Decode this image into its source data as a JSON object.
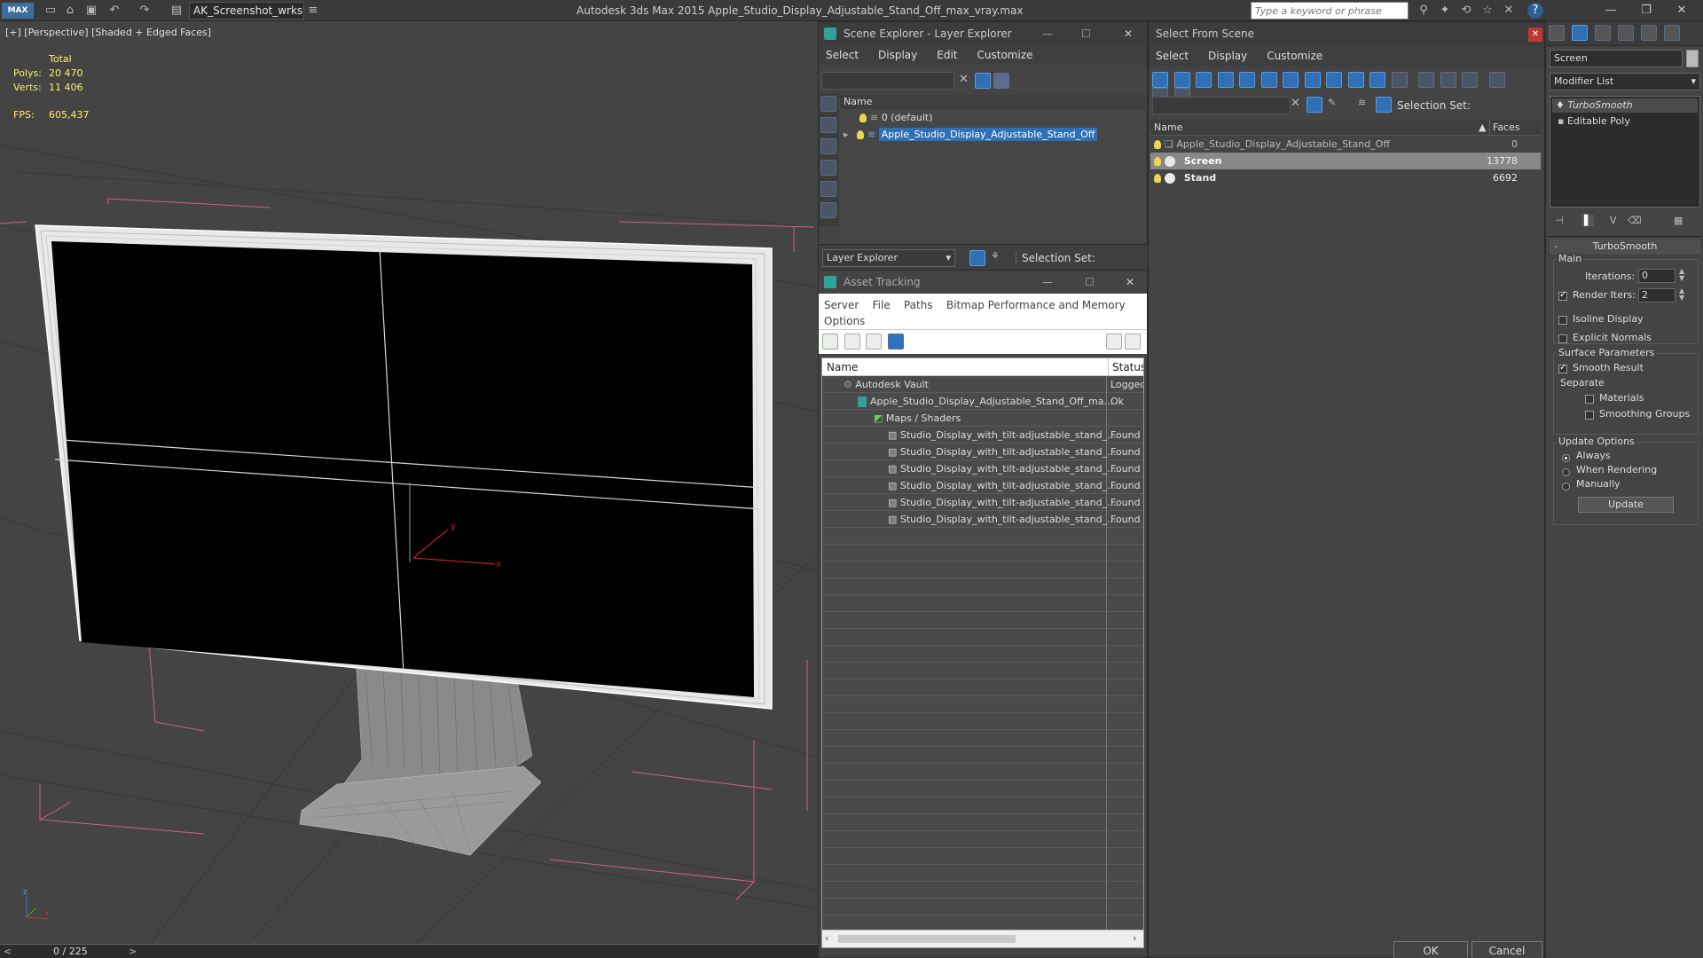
{
  "titlebar": {
    "app_title": "Autodesk 3ds Max  2015    Apple_Studio_Display_Adjustable_Stand_Off_max_vray.max",
    "workspace": "AK_Screenshot_wrksp",
    "search_placeholder": "Type a keyword or phrase",
    "logo": "MAX"
  },
  "viewport": {
    "label": "[+] [Perspective] [Shaded + Edged Faces]",
    "stats": {
      "total_label": "Total",
      "polys_label": "Polys:",
      "polys_value": "20 470",
      "verts_label": "Verts:",
      "verts_value": "11 406",
      "fps_label": "FPS:",
      "fps_value": "605,437"
    },
    "gizmo_x": "x",
    "gizmo_y": "y",
    "axis_z": "z",
    "axis_x": "x"
  },
  "timeline": {
    "frame_counter": "0 / 225",
    "prev": "<",
    "next": ">"
  },
  "scene_explorer": {
    "title": "Scene Explorer - Layer Explorer",
    "menu": [
      "Select",
      "Display",
      "Edit",
      "Customize"
    ],
    "col_name": "Name",
    "layers": [
      "0 (default)",
      "Apple_Studio_Display_Adjustable_Stand_Off"
    ],
    "footer_dropdown": "Layer Explorer",
    "selection_set_label": "Selection Set:"
  },
  "asset_tracking": {
    "title": "Asset Tracking",
    "menu": [
      "Server",
      "File",
      "Paths",
      "Bitmap Performance and Memory"
    ],
    "menu2": "Options",
    "col_name": "Name",
    "col_status": "Status",
    "rows": [
      {
        "name": "Autodesk Vault",
        "status": "Logged"
      },
      {
        "name": "Apple_Studio_Display_Adjustable_Stand_Off_ma...",
        "status": "Ok"
      },
      {
        "name": "Maps / Shaders",
        "status": ""
      },
      {
        "name": "Studio_Display_with_tilt-adjustable_stand_...",
        "status": "Found"
      },
      {
        "name": "Studio_Display_with_tilt-adjustable_stand_...",
        "status": "Found"
      },
      {
        "name": "Studio_Display_with_tilt-adjustable_stand_...",
        "status": "Found"
      },
      {
        "name": "Studio_Display_with_tilt-adjustable_stand_...",
        "status": "Found"
      },
      {
        "name": "Studio_Display_with_tilt-adjustable_stand_...",
        "status": "Found"
      },
      {
        "name": "Studio_Display_with_tilt-adjustable_stand_...",
        "status": "Found"
      }
    ]
  },
  "select_from_scene": {
    "title": "Select From Scene",
    "menu": [
      "Select",
      "Display",
      "Customize"
    ],
    "selection_set_label": "Selection Set:",
    "col_name": "Name",
    "col_faces": "Faces",
    "rows": [
      {
        "name": "Apple_Studio_Display_Adjustable_Stand_Off",
        "faces": "0"
      },
      {
        "name": "Screen",
        "faces": "13778"
      },
      {
        "name": "Stand",
        "faces": "6692"
      }
    ],
    "ok": "OK",
    "cancel": "Cancel"
  },
  "command_panel": {
    "object_name": "Screen",
    "modifier_list": "Modifier List",
    "stack": [
      "TurboSmooth",
      "Editable Poly"
    ],
    "rollout_title": "TurboSmooth",
    "main_group": "Main",
    "iterations_label": "Iterations:",
    "iterations_value": "0",
    "render_iters_label": "Render Iters:",
    "render_iters_value": "2",
    "isoline_label": "Isoline Display",
    "explicit_normals_label": "Explicit Normals",
    "surface_group": "Surface Parameters",
    "smooth_result_label": "Smooth Result",
    "separate_label": "Separate",
    "materials_label": "Materials",
    "smoothing_groups_label": "Smoothing Groups",
    "update_group": "Update Options",
    "always_label": "Always",
    "when_rendering_label": "When Rendering",
    "manually_label": "Manually",
    "update_button": "Update"
  },
  "colors": {
    "selection_blue": "#2f6fb5",
    "stats_yellow": "#ffee66",
    "bbox_pink": "#d06080"
  }
}
